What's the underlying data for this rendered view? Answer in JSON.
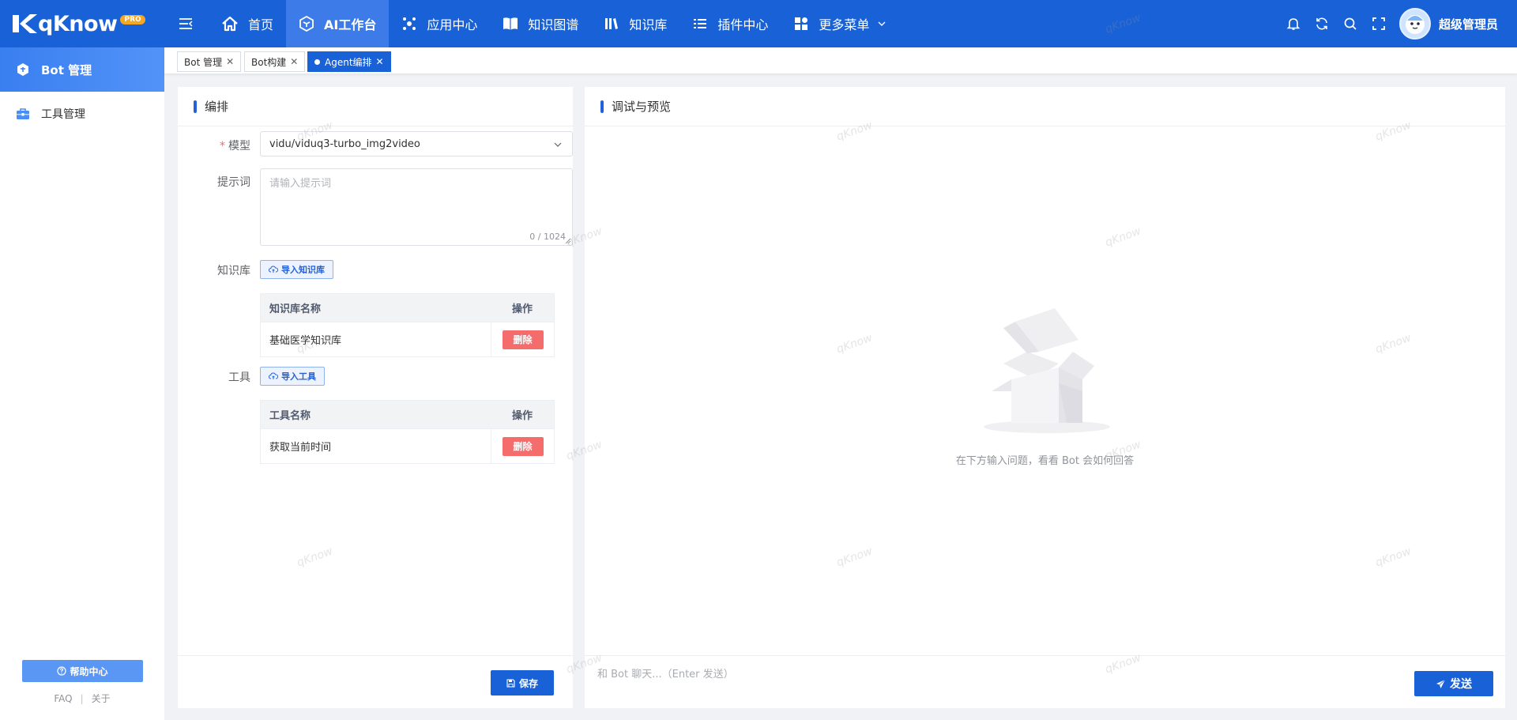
{
  "app": {
    "brand": "qKnow",
    "brand_badge": "PRO"
  },
  "nav": {
    "items": [
      {
        "label": "首页",
        "icon": "home-icon"
      },
      {
        "label": "AI工作台",
        "icon": "cube-icon",
        "active": true
      },
      {
        "label": "应用中心",
        "icon": "apps-icon"
      },
      {
        "label": "知识图谱",
        "icon": "book-icon"
      },
      {
        "label": "知识库",
        "icon": "library-icon"
      },
      {
        "label": "插件中心",
        "icon": "list-icon"
      },
      {
        "label": "更多菜单",
        "icon": "grid-icon"
      }
    ],
    "user": "超级管理员"
  },
  "sidebar": {
    "items": [
      {
        "label": "Bot 管理",
        "active": true
      },
      {
        "label": "工具管理"
      }
    ],
    "help_label": "帮助中心",
    "faq_label": "FAQ",
    "about_label": "关于"
  },
  "tabs": [
    {
      "label": "Bot 管理"
    },
    {
      "label": "Bot构建"
    },
    {
      "label": "Agent编排",
      "active": true
    }
  ],
  "editor": {
    "title": "编排",
    "model_label": "模型",
    "model_value": "vidu/viduq3-turbo_img2video",
    "prompt_label": "提示词",
    "prompt_placeholder": "请输入提示词",
    "prompt_count": "0 / 1024",
    "kb_label": "知识库",
    "kb_import": "导入知识库",
    "kb_table": {
      "headers": [
        "知识库名称",
        "操作"
      ],
      "rows": [
        {
          "name": "基础医学知识库",
          "action": "删除"
        }
      ]
    },
    "tool_label": "工具",
    "tool_import": "导入工具",
    "tool_table": {
      "headers": [
        "工具名称",
        "操作"
      ],
      "rows": [
        {
          "name": "获取当前时间",
          "action": "删除"
        }
      ]
    },
    "save_label": "保存"
  },
  "preview": {
    "title": "调试与预览",
    "empty_text": "在下方输入问题，看看 Bot 会如何回答",
    "chat_placeholder": "和 Bot 聊天...（Enter 发送）",
    "send_label": "发送"
  },
  "watermark": "qKnow",
  "colors": {
    "primary": "#1961d6",
    "danger": "#f56c6c",
    "background": "#f0f2f5"
  }
}
